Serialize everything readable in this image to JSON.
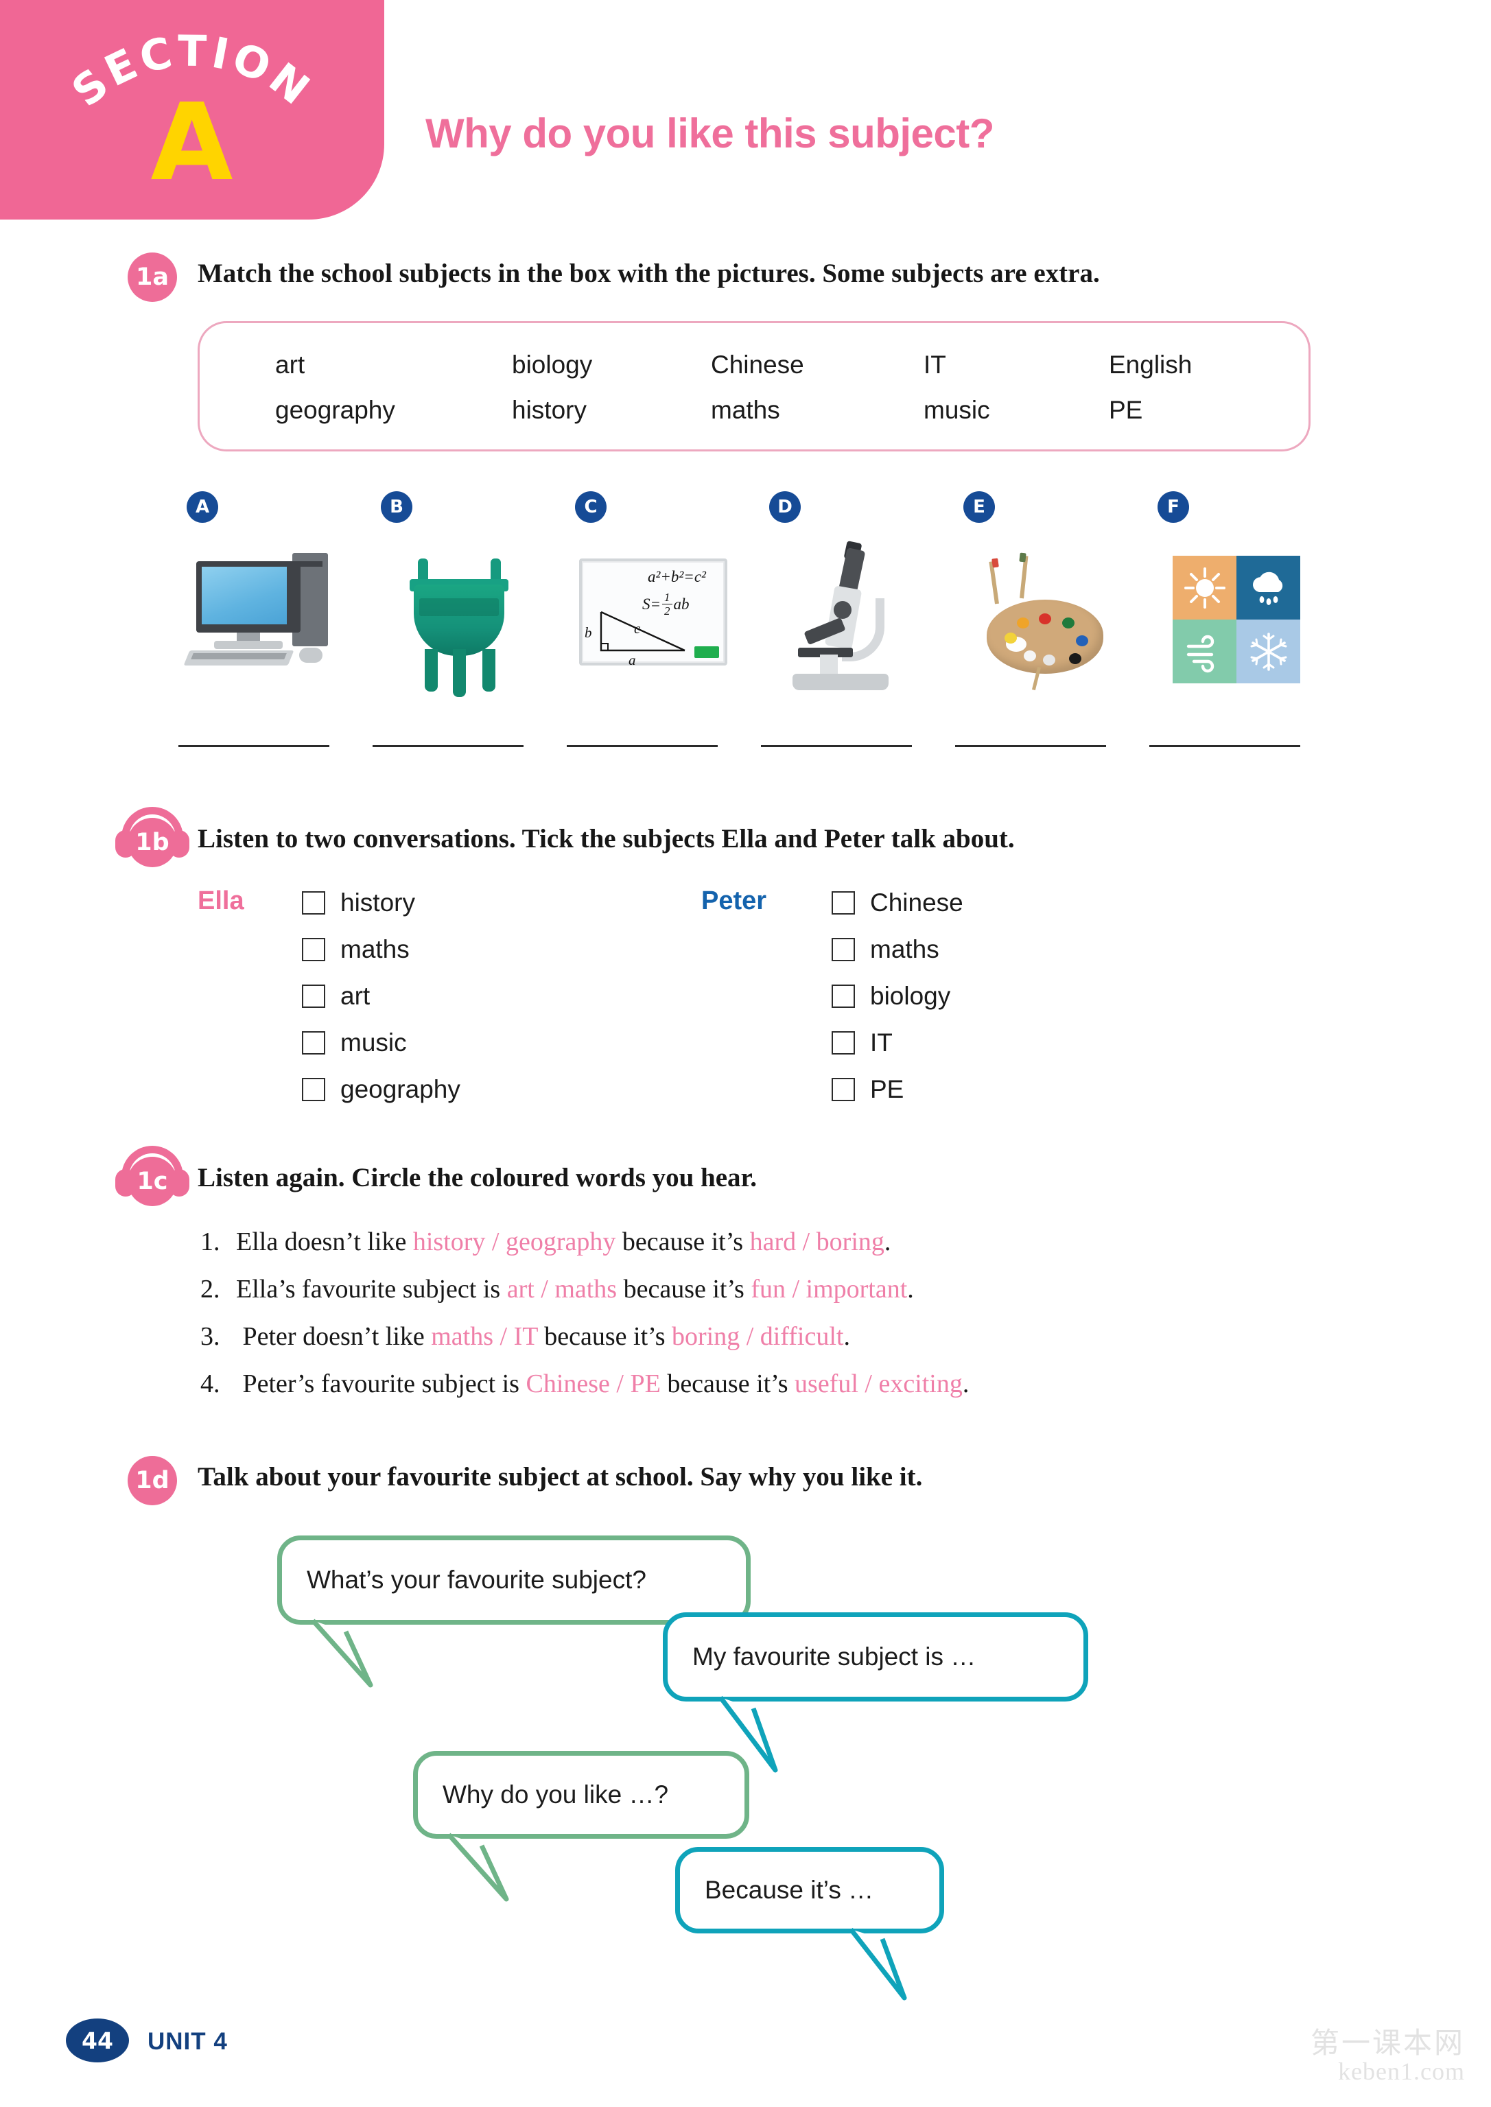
{
  "section": {
    "arc_label": "SECTION",
    "letter": "A",
    "tab_color": "#f06795",
    "letter_color": "#ffd400"
  },
  "page_title": "Why do you like this subject?",
  "title_color": "#ef6f9b",
  "tasks": {
    "a": {
      "badge": "1a",
      "instruction": "Match the school subjects in the box with the pictures. Some subjects are extra."
    },
    "b": {
      "badge": "1b",
      "instruction": "Listen to two conversations. Tick the subjects Ella and Peter talk about."
    },
    "c": {
      "badge": "1c",
      "instruction": "Listen again. Circle the coloured words you hear."
    },
    "d": {
      "badge": "1d",
      "instruction": "Talk about your favourite subject at school. Say why you like it."
    }
  },
  "word_box": {
    "words": [
      "art",
      "biology",
      "Chinese",
      "IT",
      "English",
      "geography",
      "history",
      "maths",
      "music",
      "PE"
    ]
  },
  "pictures": [
    {
      "letter": "A",
      "icon": "desktop-computer-icon",
      "answer": ""
    },
    {
      "letter": "B",
      "icon": "bronze-ding-vessel-icon",
      "answer": ""
    },
    {
      "letter": "C",
      "icon": "whiteboard-maths-icon",
      "answer": ""
    },
    {
      "letter": "D",
      "icon": "microscope-icon",
      "answer": ""
    },
    {
      "letter": "E",
      "icon": "paint-palette-icon",
      "answer": ""
    },
    {
      "letter": "F",
      "icon": "weather-tiles-icon",
      "answer": ""
    }
  ],
  "whiteboard": {
    "equation1": "a²+b²=c²",
    "equation2_left": "S=",
    "equation2_num": "1",
    "equation2_den": "2",
    "equation2_right": "ab",
    "label_a": "a",
    "label_b": "b",
    "label_c": "c"
  },
  "weather_tiles": [
    {
      "name": "sun-icon",
      "color": "#eeae6d"
    },
    {
      "name": "rain-cloud-icon",
      "color": "#1f6a97"
    },
    {
      "name": "wind-icon",
      "color": "#82cbab"
    },
    {
      "name": "snowflake-icon",
      "color": "#a9c9e6"
    }
  ],
  "tick_lists": [
    {
      "person": "Ella",
      "color": "#ef6f9b",
      "items": [
        "history",
        "maths",
        "art",
        "music",
        "geography"
      ]
    },
    {
      "person": "Peter",
      "color": "#1463ad",
      "items": [
        "Chinese",
        "maths",
        "biology",
        "IT",
        "PE"
      ]
    }
  ],
  "circle_questions": [
    {
      "num": "1.",
      "p1": "Ella doesn’t like ",
      "c1": "history / geography",
      "p2": " because it’s ",
      "c2": "hard / boring",
      "p3": "."
    },
    {
      "num": "2.",
      "p1": "Ella’s favourite subject is ",
      "c1": "art / maths",
      "p2": " because it’s ",
      "c2": "fun / important",
      "p3": "."
    },
    {
      "num": "3.",
      "p1": " Peter doesn’t like ",
      "c1": "maths / IT",
      "p2": " because it’s ",
      "c2": "boring / difficult",
      "p3": "."
    },
    {
      "num": "4.",
      "p1": " Peter’s favourite subject is ",
      "c1": "Chinese / PE",
      "p2": " because it’s ",
      "c2": "useful / exciting",
      "p3": "."
    }
  ],
  "highlight_color": "#ef7fa8",
  "speech_bubbles": [
    {
      "text": "What’s your favourite subject?",
      "color": "#6fb488"
    },
    {
      "text": "My favourite subject is …",
      "color": "#0fa3ba"
    },
    {
      "text": "Why do you like …?",
      "color": "#6fb488"
    },
    {
      "text": "Because it’s …",
      "color": "#0fa3ba"
    }
  ],
  "footer": {
    "page_number": "44",
    "unit_label": "UNIT 4",
    "watermark_cn": "第一课本网",
    "watermark_en": "keben1.com",
    "accent": "#13407f"
  }
}
